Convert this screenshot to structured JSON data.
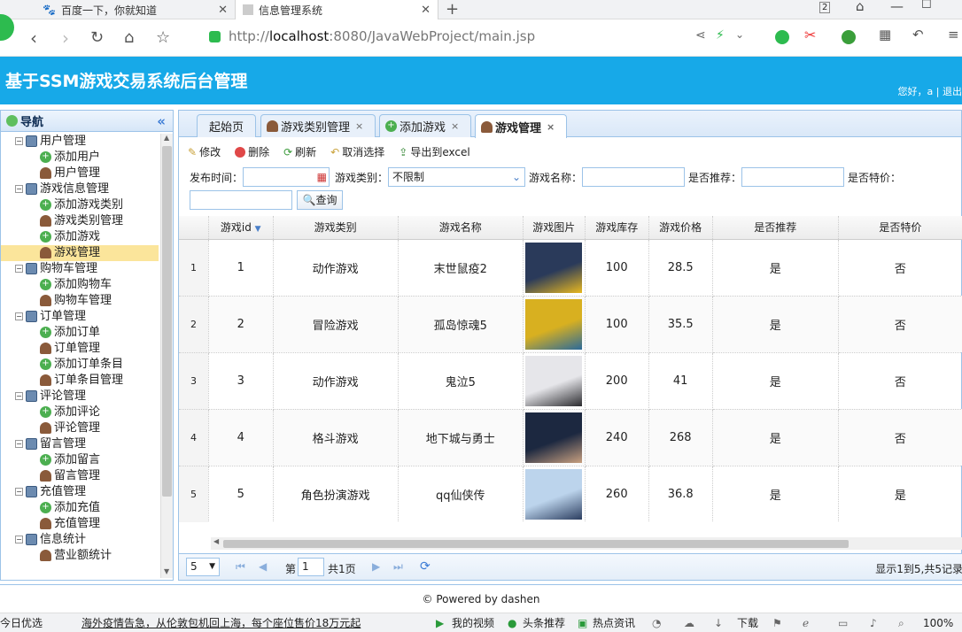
{
  "browser": {
    "tabs": [
      {
        "title": "百度一下，你就知道"
      },
      {
        "title": "信息管理系统"
      }
    ],
    "url_prefix": "http://",
    "url_host": "localhost",
    "url_rest": ":8080/JavaWebProject/main.jsp"
  },
  "header": {
    "title": "基于SSM游戏交易系统后台管理",
    "greeting": "您好，a | 退出"
  },
  "sidebar": {
    "title": "导航",
    "collapse": "«",
    "groups": [
      {
        "label": "用户管理",
        "items": [
          "添加用户",
          "用户管理"
        ]
      },
      {
        "label": "游戏信息管理",
        "items": [
          "添加游戏类别",
          "游戏类别管理",
          "添加游戏",
          "游戏管理"
        ]
      },
      {
        "label": "购物车管理",
        "items": [
          "添加购物车",
          "购物车管理"
        ]
      },
      {
        "label": "订单管理",
        "items": [
          "添加订单",
          "订单管理",
          "添加订单条目",
          "订单条目管理"
        ]
      },
      {
        "label": "评论管理",
        "items": [
          "添加评论",
          "评论管理"
        ]
      },
      {
        "label": "留言管理",
        "items": [
          "添加留言",
          "留言管理"
        ]
      },
      {
        "label": "充值管理",
        "items": [
          "添加充值",
          "充值管理"
        ]
      },
      {
        "label": "信息统计",
        "items": [
          "营业额统计"
        ]
      }
    ]
  },
  "tabs": [
    "起始页",
    "游戏类别管理",
    "添加游戏",
    "游戏管理"
  ],
  "actions": [
    "修改",
    "删除",
    "刷新",
    "取消选择",
    "导出到excel"
  ],
  "filters": {
    "publish_time": "发布时间：",
    "category": "游戏类别：",
    "category_value": "不限制",
    "name": "游戏名称：",
    "recommend": "是否推荐：",
    "special": "是否特价：",
    "query": "查询"
  },
  "grid": {
    "columns": [
      "游戏id",
      "游戏类别",
      "游戏名称",
      "游戏图片",
      "游戏库存",
      "游戏价格",
      "是否推荐",
      "是否特价"
    ],
    "rows": [
      {
        "rn": "1",
        "id": "1",
        "cat": "动作游戏",
        "name": "末世鼠疫2",
        "stock": "100",
        "price": "28.5",
        "rec": "是",
        "spec": "否"
      },
      {
        "rn": "2",
        "id": "2",
        "cat": "冒险游戏",
        "name": "孤岛惊魂5",
        "stock": "100",
        "price": "35.5",
        "rec": "是",
        "spec": "否"
      },
      {
        "rn": "3",
        "id": "3",
        "cat": "动作游戏",
        "name": "鬼泣5",
        "stock": "200",
        "price": "41",
        "rec": "是",
        "spec": "否"
      },
      {
        "rn": "4",
        "id": "4",
        "cat": "格斗游戏",
        "name": "地下城与勇士",
        "stock": "240",
        "price": "268",
        "rec": "是",
        "spec": "否"
      },
      {
        "rn": "5",
        "id": "5",
        "cat": "角色扮演游戏",
        "name": "qq仙侠传",
        "stock": "260",
        "price": "36.8",
        "rec": "是",
        "spec": "是"
      }
    ]
  },
  "pager": {
    "page_size": "5",
    "page_prefix": "第",
    "page": "1",
    "page_suffix": "共1页",
    "summary": "显示1到5,共5记录"
  },
  "footer": "© Powered by dashen",
  "statusbar": {
    "left": "今日优选",
    "news": "海外疫情告急，从伦敦包机回上海，每个座位售价18万元起",
    "items": [
      "我的视频",
      "头条推荐",
      "热点资讯",
      "下载",
      "100%"
    ]
  }
}
